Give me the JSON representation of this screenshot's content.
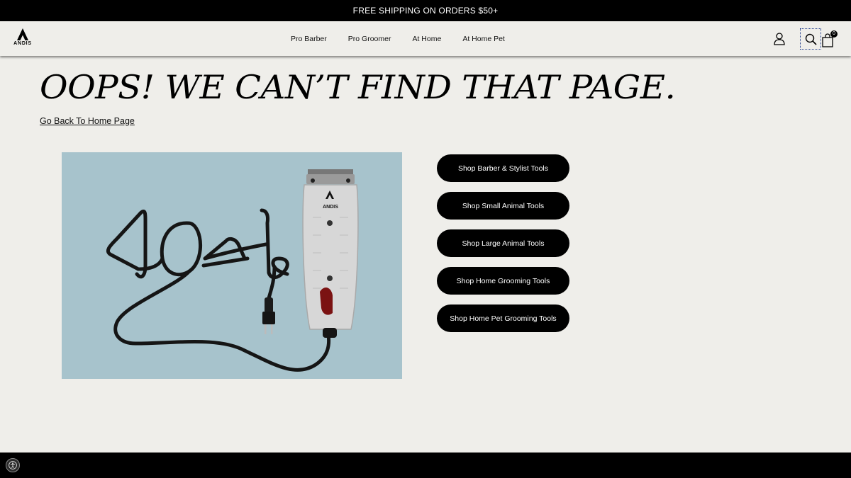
{
  "promo": {
    "text": "FREE SHIPPING ON ORDERS $50+"
  },
  "header": {
    "logo_text": "ANDIS",
    "nav": [
      "Pro Barber",
      "Pro Groomer",
      "At Home",
      "At Home Pet"
    ],
    "cart_count": "0"
  },
  "main": {
    "title": "OOPS! WE CAN’T FIND THAT PAGE.",
    "home_link": "Go Back To Home Page",
    "hero_image": {
      "clipper_brand": "ANDIS"
    },
    "buttons": [
      "Shop Barber & Stylist Tools",
      "Shop Small Animal Tools",
      "Shop Large Animal Tools",
      "Shop Home Grooming Tools",
      "Shop Home Pet Grooming Tools"
    ]
  },
  "colors": {
    "background": "#efeeea",
    "primary": "#000000",
    "hero_bg": "#a7c3cc"
  }
}
